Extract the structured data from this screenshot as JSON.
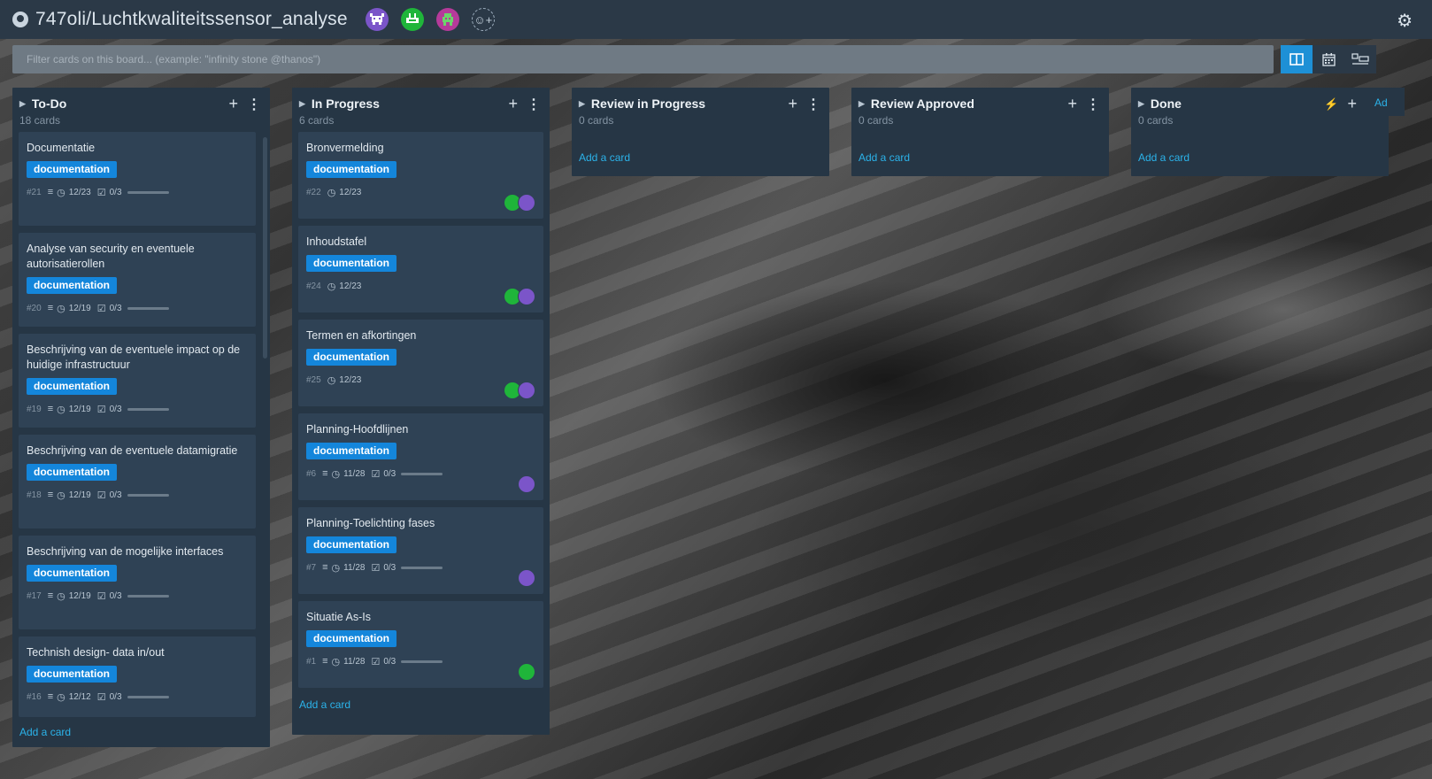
{
  "header": {
    "repo_title": "747oli/Luchtkwaliteitssensor_analyse",
    "members": [
      "purple-invader-avatar",
      "green-invader-avatar",
      "pink-invader-avatar"
    ],
    "add_member_icon": "add-member-icon",
    "settings_icon": "gear-icon"
  },
  "filter": {
    "placeholder": "Filter cards on this board... (example: \"infinity stone @thanos\")"
  },
  "views": [
    "board-view-icon",
    "calendar-view-icon",
    "swimlane-view-icon"
  ],
  "colors": {
    "label": "#1486db",
    "link": "#2bb3ea",
    "list_bg": "#263645",
    "card_bg": "#2f4255"
  },
  "lists": [
    {
      "title": "To-Do",
      "count": "18 cards",
      "add_card": "Add a card",
      "cards": [
        {
          "title": "Documentatie",
          "label": "documentation",
          "num": "#21",
          "date": "12/23",
          "check": "0/3"
        },
        {
          "title": "Analyse van security en eventuele autorisatierollen",
          "label": "documentation",
          "num": "#20",
          "date": "12/19",
          "check": "0/3"
        },
        {
          "title": "Beschrijving van de eventuele impact op de huidige infrastructuur",
          "label": "documentation",
          "num": "#19",
          "date": "12/19",
          "check": "0/3"
        },
        {
          "title": "Beschrijving van de eventuele datamigratie",
          "label": "documentation",
          "num": "#18",
          "date": "12/19",
          "check": "0/3"
        },
        {
          "title": "Beschrijving van de mogelijke interfaces",
          "label": "documentation",
          "num": "#17",
          "date": "12/19",
          "check": "0/3"
        },
        {
          "title": "Technish design- data in/out",
          "label": "documentation",
          "num": "#16",
          "date": "12/12",
          "check": "0/3"
        }
      ]
    },
    {
      "title": "In Progress",
      "count": "6 cards",
      "add_card": "Add a card",
      "cards": [
        {
          "title": "Bronvermelding",
          "label": "documentation",
          "num": "#22",
          "date": "12/23"
        },
        {
          "title": "Inhoudstafel",
          "label": "documentation",
          "num": "#24",
          "date": "12/23"
        },
        {
          "title": "Termen en afkortingen",
          "label": "documentation",
          "num": "#25",
          "date": "12/23"
        },
        {
          "title": "Planning-Hoofdlijnen",
          "label": "documentation",
          "num": "#6",
          "date": "11/28",
          "check": "0/3"
        },
        {
          "title": "Planning-Toelichting fases",
          "label": "documentation",
          "num": "#7",
          "date": "11/28",
          "check": "0/3"
        },
        {
          "title": "Situatie As-Is",
          "label": "documentation",
          "num": "#1",
          "date": "11/28",
          "check": "0/3"
        }
      ]
    },
    {
      "title": "Review in Progress",
      "count": "0 cards",
      "add_card": "Add a card"
    },
    {
      "title": "Review Approved",
      "count": "0 cards",
      "add_card": "Add a card"
    },
    {
      "title": "Done",
      "count": "0 cards",
      "add_card": "Add a card"
    }
  ],
  "cutoff_list_text": "Ad"
}
